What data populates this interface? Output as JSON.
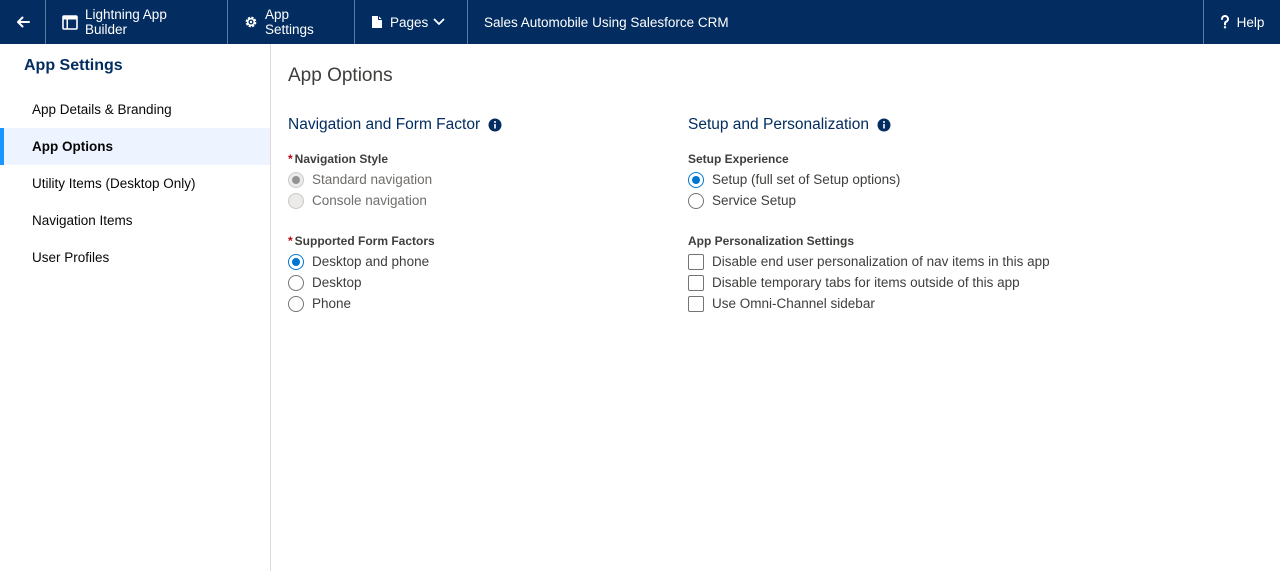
{
  "topbar": {
    "back_icon": "arrow-left-icon",
    "builder_label": "Lightning App Builder",
    "builder_icon": "app-layout-icon",
    "settings_label": "App Settings",
    "settings_icon": "gear-icon",
    "pages_label": "Pages",
    "pages_icon": "page-icon",
    "app_name": "Sales Automobile Using Salesforce CRM",
    "help_label": "Help",
    "help_icon": "question-icon"
  },
  "sidebar": {
    "heading": "App Settings",
    "items": [
      {
        "label": "App Details & Branding",
        "active": false
      },
      {
        "label": "App Options",
        "active": true
      },
      {
        "label": "Utility Items (Desktop Only)",
        "active": false
      },
      {
        "label": "Navigation Items",
        "active": false
      },
      {
        "label": "User Profiles",
        "active": false
      }
    ]
  },
  "main": {
    "title": "App Options",
    "nav_section": {
      "title": "Navigation and Form Factor",
      "nav_style": {
        "label": "Navigation Style",
        "required": "*",
        "options": [
          {
            "label": "Standard navigation",
            "checked": true,
            "disabled": true
          },
          {
            "label": "Console navigation",
            "checked": false,
            "disabled": true
          }
        ]
      },
      "form_factors": {
        "label": "Supported Form Factors",
        "required": "*",
        "options": [
          {
            "label": "Desktop and phone",
            "checked": true
          },
          {
            "label": "Desktop",
            "checked": false
          },
          {
            "label": "Phone",
            "checked": false
          }
        ]
      }
    },
    "setup_section": {
      "title": "Setup and Personalization",
      "setup_experience": {
        "label": "Setup Experience",
        "options": [
          {
            "label": "Setup (full set of Setup options)",
            "checked": true
          },
          {
            "label": "Service Setup",
            "checked": false
          }
        ]
      },
      "personalization": {
        "label": "App Personalization Settings",
        "options": [
          {
            "label": "Disable end user personalization of nav items in this app",
            "checked": false
          },
          {
            "label": "Disable temporary tabs for items outside of this app",
            "checked": false
          },
          {
            "label": "Use Omni-Channel sidebar",
            "checked": false
          }
        ]
      }
    }
  },
  "colors": {
    "header_bg": "#032d60",
    "accent": "#0176d3",
    "active_bar": "#1b96ff",
    "active_bg": "#eef4ff",
    "required": "#ba0517"
  }
}
